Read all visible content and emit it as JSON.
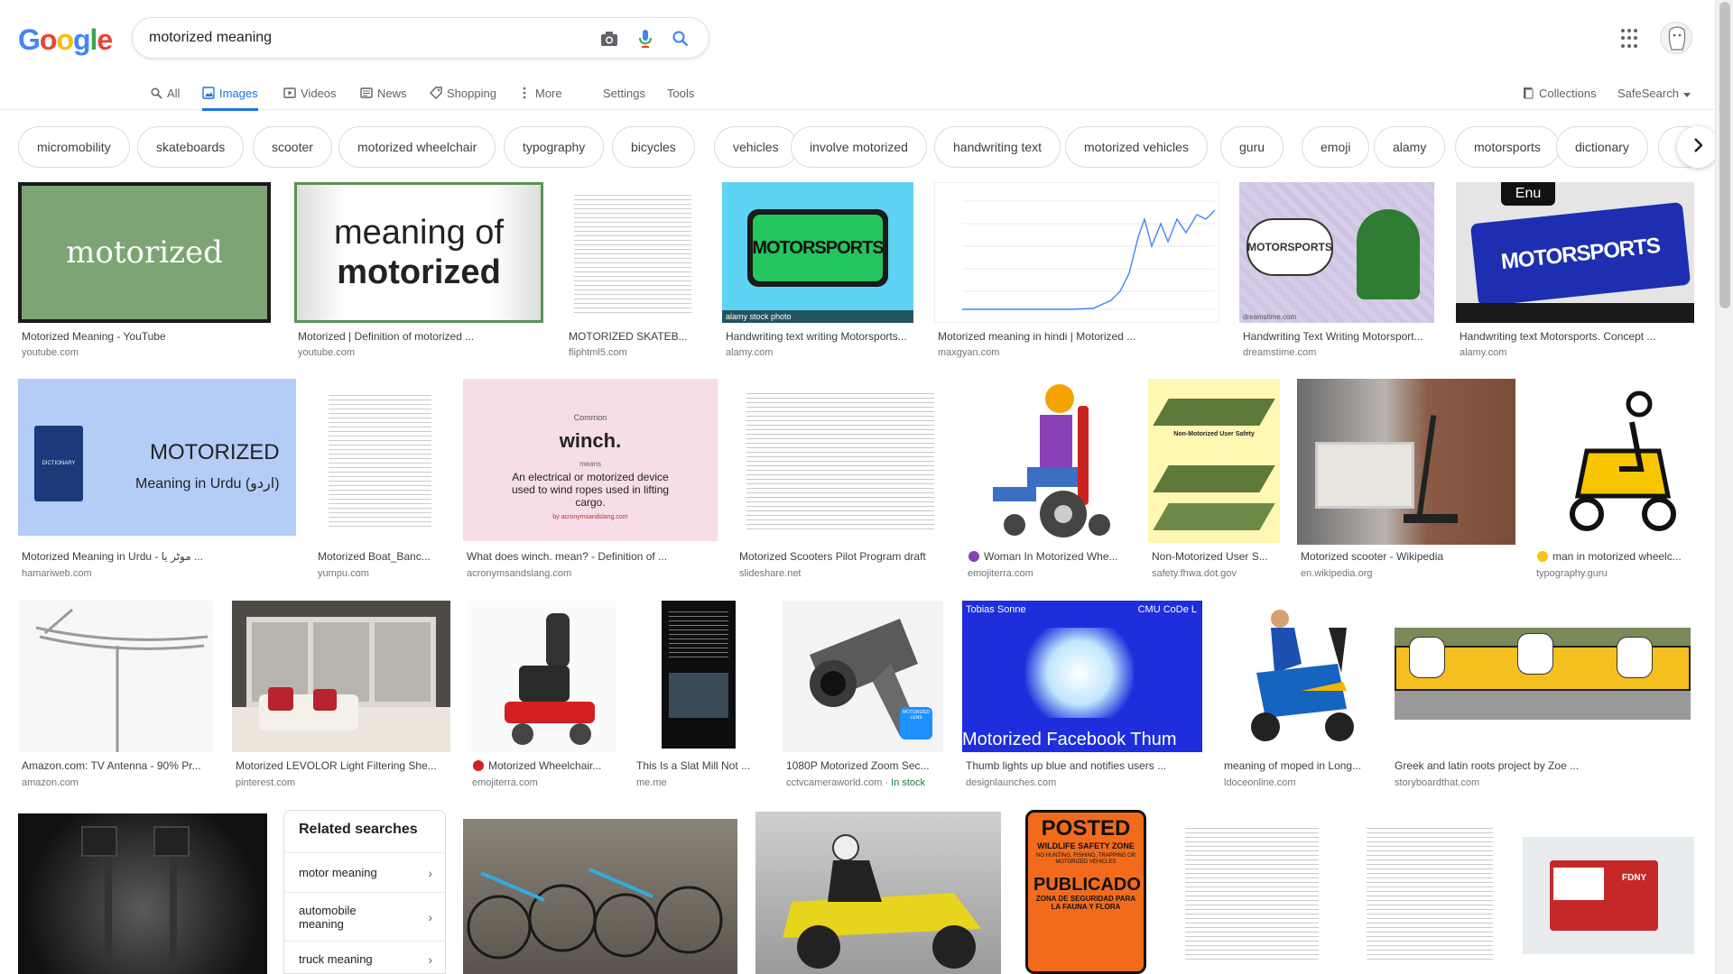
{
  "search": {
    "query": "motorized meaning"
  },
  "logo": {
    "letters": [
      "G",
      "o",
      "o",
      "g",
      "l",
      "e"
    ],
    "colors": [
      "#4285F4",
      "#EA4335",
      "#FBBC05",
      "#4285F4",
      "#34A853",
      "#EA4335"
    ]
  },
  "tabs": [
    {
      "label": "All",
      "icon": "search-icon"
    },
    {
      "label": "Images",
      "icon": "image-icon"
    },
    {
      "label": "Videos",
      "icon": "play-icon"
    },
    {
      "label": "News",
      "icon": "news-icon"
    },
    {
      "label": "Shopping",
      "icon": "tag-icon"
    },
    {
      "label": "More",
      "icon": "more-vert-icon"
    }
  ],
  "tools": {
    "settings": "Settings",
    "tools": "Tools",
    "collections": "Collections",
    "safesearch": "SafeSearch"
  },
  "chips": [
    "micromobility",
    "skateboards",
    "scooter",
    "motorized wheelchair",
    "typography",
    "bicycles",
    "vehicles",
    "involve motorized",
    "handwriting text",
    "motorized vehicles",
    "guru",
    "emoji",
    "alamy",
    "motorsports",
    "dictionary",
    "bi"
  ],
  "results_row1": [
    {
      "caption": "Motorized Meaning - YouTube",
      "source": "youtube.com"
    },
    {
      "caption": "Motorized | Definition of motorized ...",
      "source": "youtube.com"
    },
    {
      "caption": "MOTORIZED SKATEB...",
      "source": "fliphtml5.com"
    },
    {
      "caption": "Handwriting text writing Motorsports...",
      "source": "alamy.com"
    },
    {
      "caption": "Motorized meaning in hindi | Motorized ...",
      "source": "maxgyan.com"
    },
    {
      "caption": "Handwriting Text Writing Motorsport...",
      "source": "dreamstime.com"
    },
    {
      "caption": "Handwriting text Motorsports. Concept ...",
      "source": "alamy.com"
    }
  ],
  "results_row2": [
    {
      "caption": "Motorized Meaning in Urdu - موٹر یا ...",
      "source": "hamariweb.com"
    },
    {
      "caption": "Motorized Boat_Banc...",
      "source": "yumpu.com"
    },
    {
      "caption": "What does winch. mean? - Definition of ...",
      "source": "acronymsandslang.com"
    },
    {
      "caption": "Motorized Scooters Pilot Program draft",
      "source": "slideshare.net"
    },
    {
      "caption": "Woman In Motorized Whe...",
      "source": "emojiterra.com"
    },
    {
      "caption": "Non-Motorized User S...",
      "source": "safety.fhwa.dot.gov"
    },
    {
      "caption": "Motorized scooter - Wikipedia",
      "source": "en.wikipedia.org"
    },
    {
      "caption": "man in motorized wheelc...",
      "source": "typography.guru"
    }
  ],
  "results_row3": [
    {
      "caption": "Amazon.com: TV Antenna - 90% Pr...",
      "source": "amazon.com"
    },
    {
      "caption": "Motorized LEVOLOR Light Filtering She...",
      "source": "pinterest.com"
    },
    {
      "caption": "Motorized Wheelchair...",
      "source": "emojiterra.com"
    },
    {
      "caption": "This Is a Slat Mill Not ...",
      "source": "me.me"
    },
    {
      "caption": "1080P Motorized Zoom Sec...",
      "source": "cctvcameraworld.com",
      "stock": "In stock"
    },
    {
      "caption": "Thumb lights up blue and notifies users ...",
      "source": "designlaunches.com"
    },
    {
      "caption": "meaning of moped in Long...",
      "source": "ldoceonline.com"
    },
    {
      "caption": "Greek and latin roots project by Zoe ...",
      "source": "storyboardthat.com"
    }
  ],
  "thumb_text": {
    "motorized": "motorized",
    "meaning_of": "meaning of",
    "motorized_bold": "motorized",
    "motorsports": "MOTORSPORTS",
    "alamy": "alamy stock photo",
    "dreamstime": "dreamstime.com",
    "urdu_title": "MOTORIZED",
    "urdu_sub": "Meaning in Urdu (اردو)",
    "dictionary": "DICTIONARY",
    "winch_common": "Common",
    "winch_word": "winch.",
    "winch_means": "means",
    "winch_def": "An electrical or motorized device used to wind ropes used in lifting cargo.",
    "winch_site": "by acronymsandslang.com",
    "nonmotorized": "Non-Motorized User Safety",
    "cctv_badge": "MOTORIZED LENS",
    "fb_top_left": "Tobias Sonne",
    "fb_top_right": "CMU CoDe L",
    "fb_bottom": "Motorized Facebook Thum",
    "enu": "Enu",
    "posted": "POSTED",
    "posted_sub": "WILDLIFE SAFETY ZONE",
    "posted_lines": "NO HUNTING, FISHING, TRAPPING OR MOTORIZED VEHICLES",
    "publicado": "PUBLICADO",
    "publicado_sub": "ZONA DE SEGURIDAD PARA LA FAUNA Y FLORA",
    "fdny": "FDNY"
  },
  "related": {
    "title": "Related searches",
    "items": [
      "motor meaning",
      "automobile meaning",
      "truck meaning"
    ]
  }
}
